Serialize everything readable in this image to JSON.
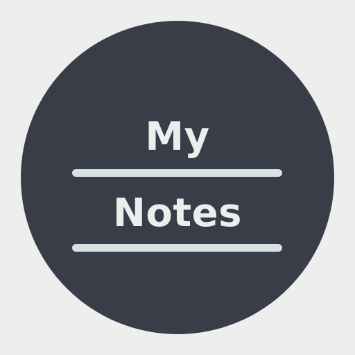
{
  "logo": {
    "line1": "My",
    "line2": "Notes"
  },
  "colors": {
    "background": "#eeeeee",
    "badge": "#393d47",
    "text": "#eceeee",
    "rule": "#d6e2e2"
  }
}
